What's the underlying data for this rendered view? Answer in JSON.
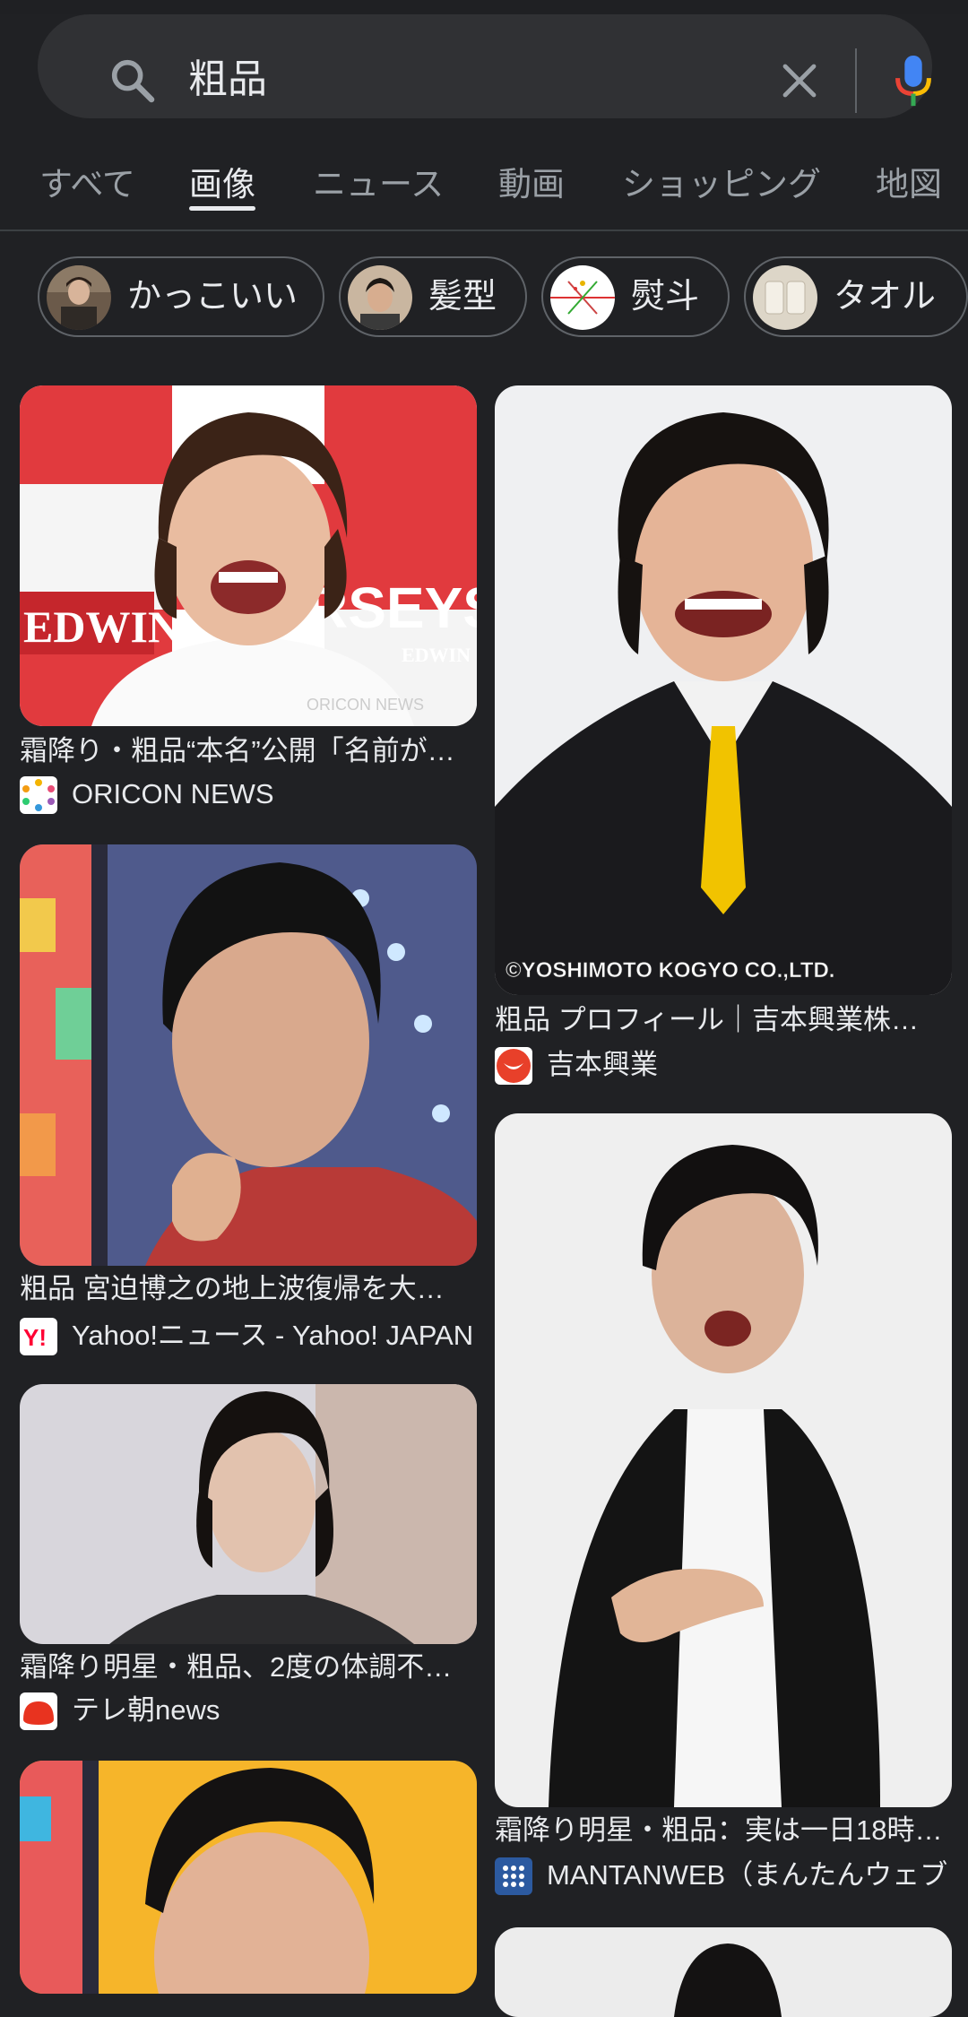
{
  "search": {
    "query": "粗品"
  },
  "tabs": [
    {
      "label": "すべて",
      "active": false
    },
    {
      "label": "画像",
      "active": true
    },
    {
      "label": "ニュース",
      "active": false
    },
    {
      "label": "動画",
      "active": false
    },
    {
      "label": "ショッピング",
      "active": false
    },
    {
      "label": "地図",
      "active": false
    }
  ],
  "chips": [
    {
      "label": "かっこいい"
    },
    {
      "label": "髪型"
    },
    {
      "label": "熨斗"
    },
    {
      "label": "タオル"
    }
  ],
  "results": [
    {
      "title": "霜降り・粗品“本名”公開「名前が…",
      "source": "ORICON NEWS",
      "watermark": "ORICON NEWS",
      "image_text": [
        "EDWIN",
        "RSEYS",
        "EDWIN"
      ]
    },
    {
      "title": "粗品 プロフィール｜吉本興業株…",
      "source": "吉本興業",
      "watermark": "©YOSHIMOTO KOGYO CO.,LTD."
    },
    {
      "title": "粗品 宮迫博之の地上波復帰を大…",
      "source": "Yahoo!ニュース - Yahoo! JAPAN"
    },
    {
      "title": "霜降り明星・粗品、2度の体調不…",
      "source": "テレ朝news"
    },
    {
      "title": "霜降り明星・粗品：実は一日18時…",
      "source": "MANTANWEB（まんたんウェブ"
    }
  ],
  "colors": {
    "background": "#202124",
    "search_bar": "#303134",
    "text_primary": "#e8eaed",
    "text_secondary": "#9aa0a6"
  }
}
